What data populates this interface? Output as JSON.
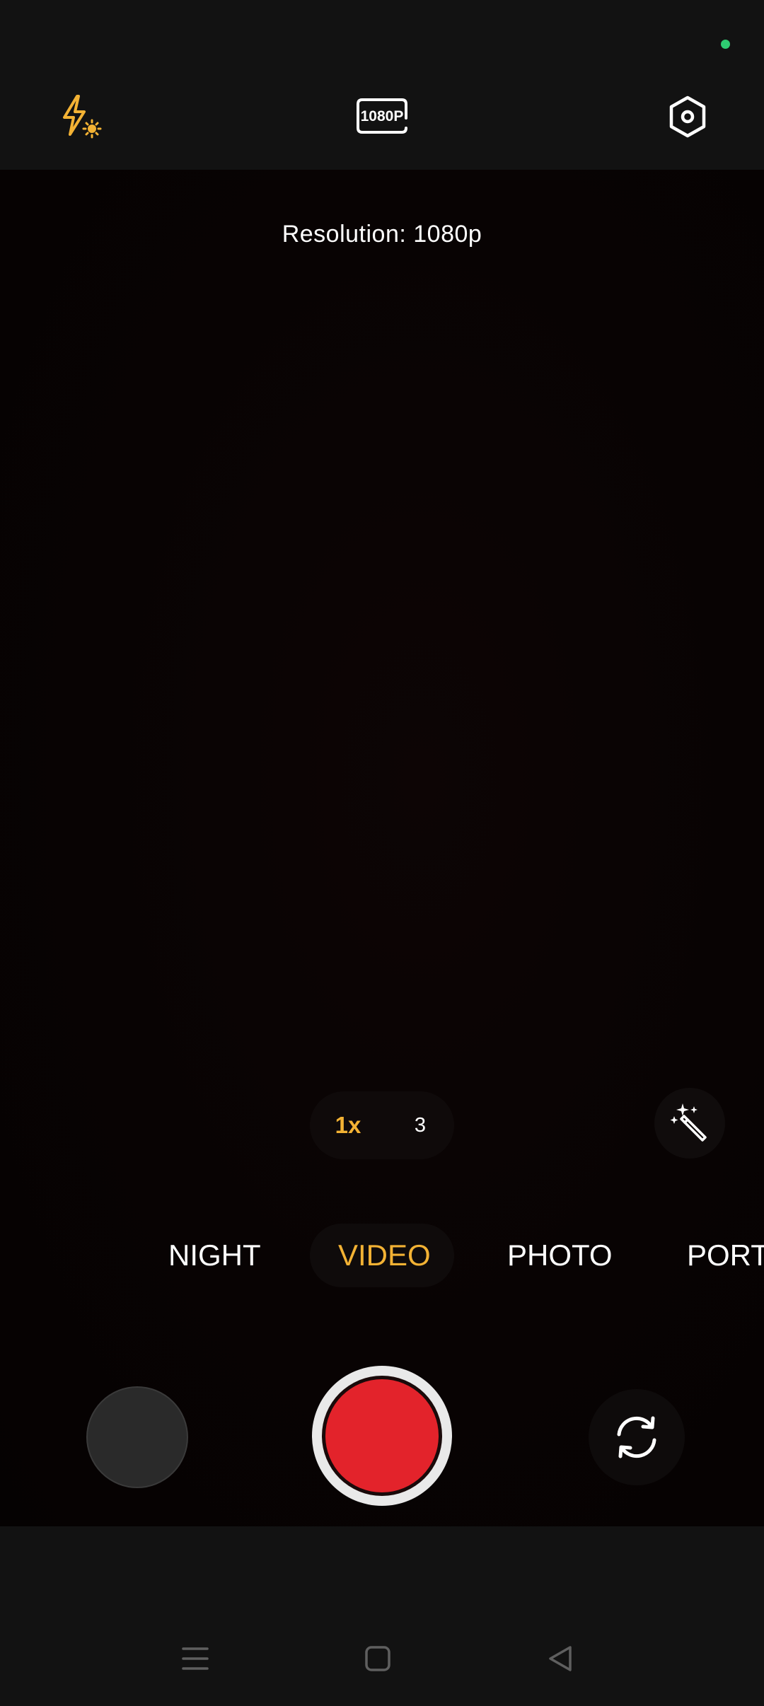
{
  "status_bar": {
    "mic_indicator_icon": "green-dot",
    "indicator_color": "#2ecc71"
  },
  "toolbar": {
    "flash_icon": "flash-auto-icon",
    "resolution_badge": "1080P",
    "settings_icon": "settings-hexagon-icon",
    "accent_color": "#f3b234"
  },
  "viewfinder": {
    "toast": "Resolution: 1080p"
  },
  "zoom": {
    "options": [
      "1x",
      "3"
    ],
    "selected": "1x"
  },
  "effects": {
    "icon": "magic-wand-icon"
  },
  "modes": {
    "items": [
      "NIGHT",
      "VIDEO",
      "PHOTO",
      "PORT"
    ],
    "selected": "VIDEO"
  },
  "controls": {
    "thumbnail_icon": "gallery-thumbnail",
    "shutter_color": "#e3232b",
    "switch_icon": "camera-switch-icon"
  },
  "nav_bar": {
    "items": [
      "menu-icon",
      "home-icon",
      "back-icon"
    ]
  }
}
